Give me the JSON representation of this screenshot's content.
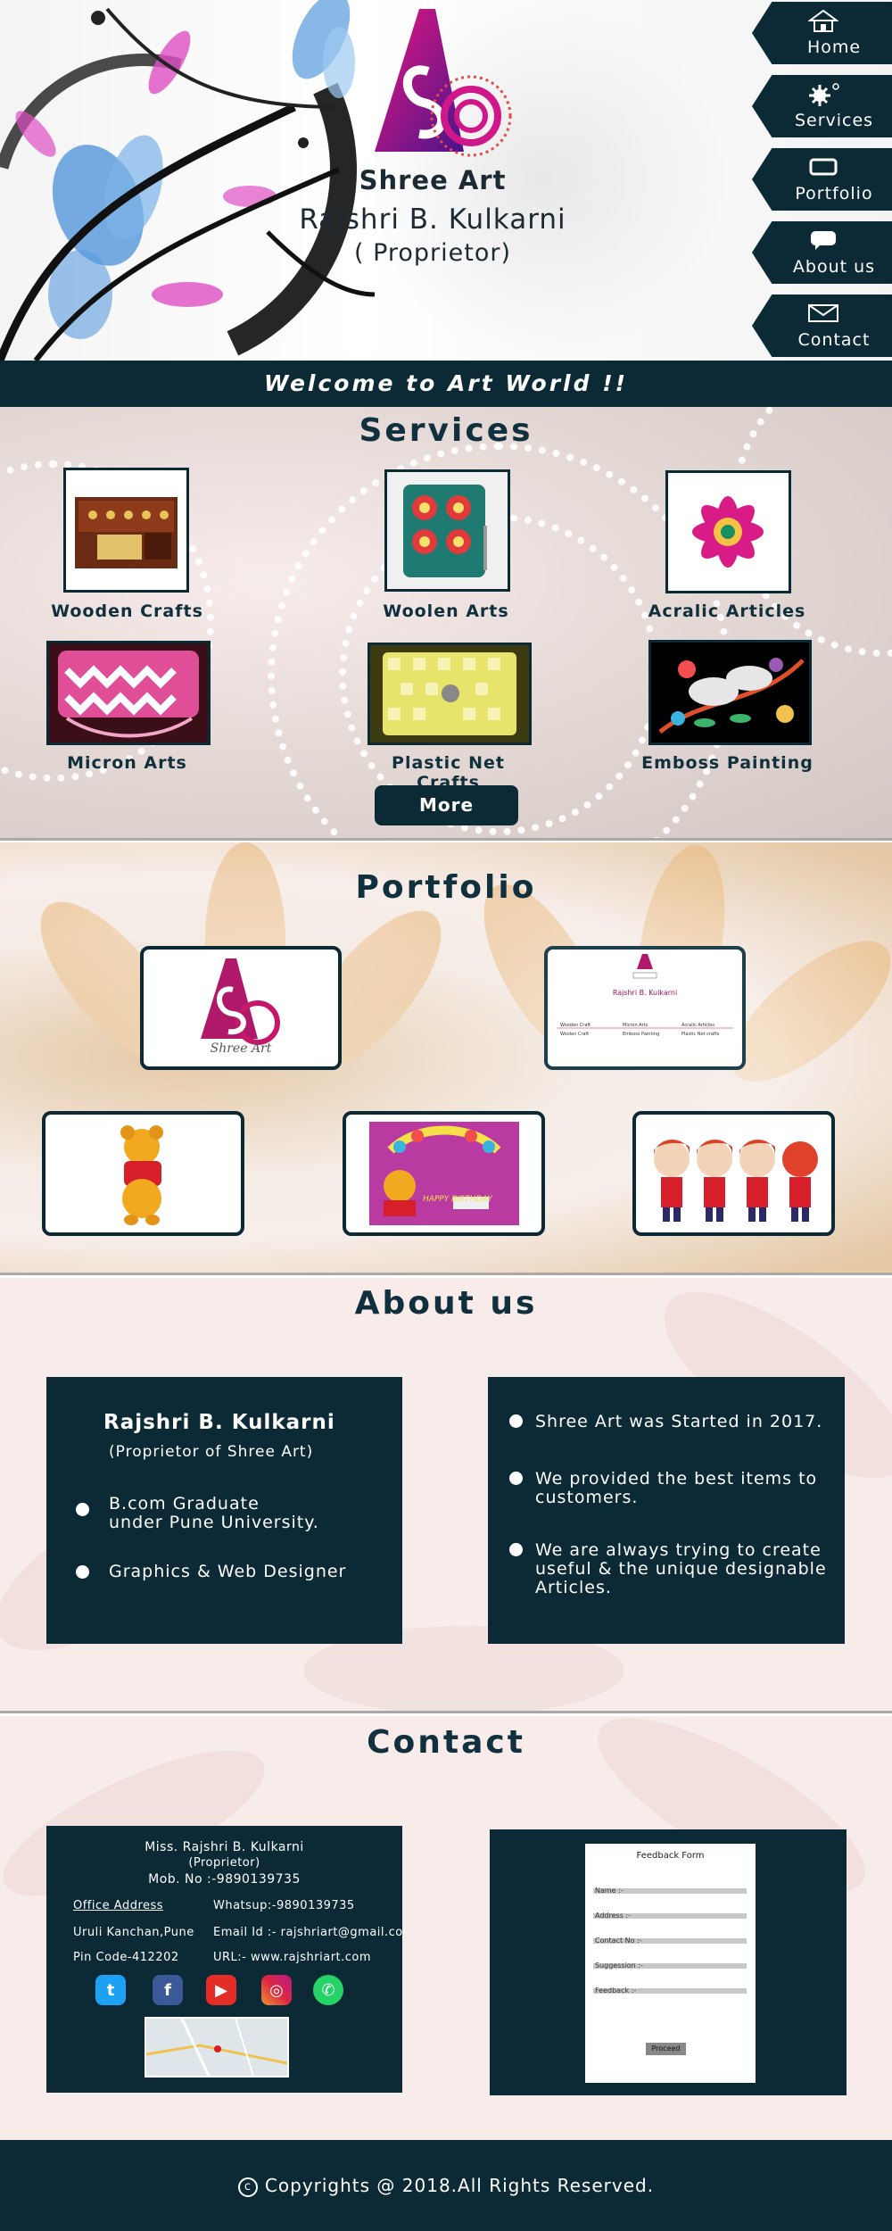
{
  "header": {
    "brand": "Shree Art",
    "owner": "Rajshri B. Kulkarni",
    "role": "( Proprietor)"
  },
  "nav": [
    {
      "label": "Home",
      "icon": "home-icon"
    },
    {
      "label": "Services",
      "icon": "gear-icon"
    },
    {
      "label": "Portfolio",
      "icon": "portfolio-icon"
    },
    {
      "label": "About us",
      "icon": "chat-icon"
    },
    {
      "label": "Contact",
      "icon": "envelope-icon"
    }
  ],
  "welcome": "Welcome to Art World !!",
  "services": {
    "title": "Services",
    "items": [
      {
        "label": "Wooden Crafts"
      },
      {
        "label": "Woolen Arts"
      },
      {
        "label": "Acralic Articles"
      },
      {
        "label": "Micron Arts"
      },
      {
        "label": "Plastic Net Crafts"
      },
      {
        "label": "Emboss Painting"
      }
    ],
    "more_label": "More"
  },
  "portfolio": {
    "title": "Portfolio",
    "logo_text": "Shree Art",
    "card": {
      "name": "Rajshri B. Kulkarni",
      "items": [
        "Wooden Craft",
        "Woolen Craft",
        "Micron Arts",
        "Emboss Painting",
        "Acralic Articles",
        "Plastic Net crafts"
      ]
    },
    "birthday_text": "HAPPY BIRTHDAY"
  },
  "about": {
    "title": "About us",
    "left": {
      "name": "Rajshri B. Kulkarni",
      "subtitle": "(Proprietor of Shree Art)",
      "points": [
        "B.com Graduate\nunder Pune University.",
        "Graphics & Web Designer"
      ]
    },
    "right": {
      "points": [
        "Shree Art was Started in 2017.",
        "We provided the best items to customers.",
        "We are always trying to create useful & the unique designable Articles."
      ]
    }
  },
  "contact": {
    "title": "Contact",
    "name": "Miss. Rajshri B. Kulkarni",
    "role": "(Proprietor)",
    "mobile": "Mob. No :-9890139735",
    "office_label": "Office Address",
    "address1": "Uruli Kanchan,Pune",
    "address2": "Pin Code-412202",
    "whatsup": "Whatsup:-9890139735",
    "email": "Email Id :- rajshriart@gmail.com",
    "url": "URL:- www.rajshriart.com",
    "social": [
      "twitter-icon",
      "facebook-icon",
      "youtube-icon",
      "instagram-icon",
      "whatsapp-icon"
    ],
    "form": {
      "title": "Feedback Form",
      "fields": [
        "Name :-",
        "Address :-",
        "Contact No :-",
        "Suggession :-",
        "Feedback :-"
      ],
      "submit": "Proceed"
    }
  },
  "footer": {
    "copyright": "Copyrights @ 2018.All Rights Reserved."
  },
  "colors": {
    "accent": "#0b2a36",
    "pink": "#d81b86",
    "purple": "#6a1b9a"
  }
}
